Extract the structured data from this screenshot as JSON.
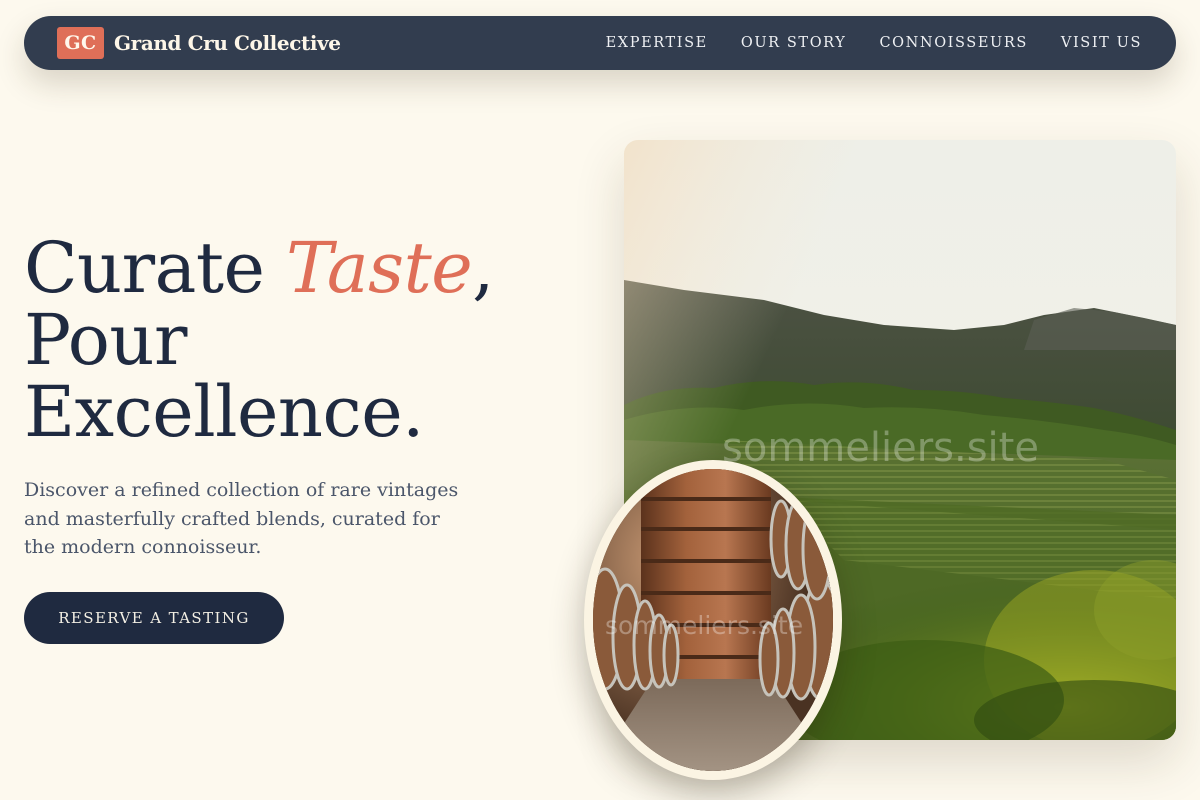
{
  "brand": {
    "logo_text": "GC",
    "name": "Grand Cru Collective"
  },
  "nav": {
    "items": [
      {
        "label": "EXPERTISE"
      },
      {
        "label": "OUR STORY"
      },
      {
        "label": "CONNOISSEURS"
      },
      {
        "label": "VISIT US"
      }
    ]
  },
  "hero": {
    "headline_part1": "Curate ",
    "headline_accent": "Taste",
    "headline_part2": ",",
    "headline_line2": "Pour",
    "headline_line3": "Excellence.",
    "subtext": "Discover a refined collection of rare vintages and masterfully crafted blends, curated for the modern connoisseur.",
    "cta_label": "RESERVE A TASTING"
  },
  "images": {
    "vineyard_watermark": "sommeliers.site",
    "barrels_watermark": "sommeliers.site"
  },
  "colors": {
    "background": "#fdf9ee",
    "nav": "#323d4f",
    "accent": "#df6f58",
    "dark_navy": "#1f2a40"
  }
}
